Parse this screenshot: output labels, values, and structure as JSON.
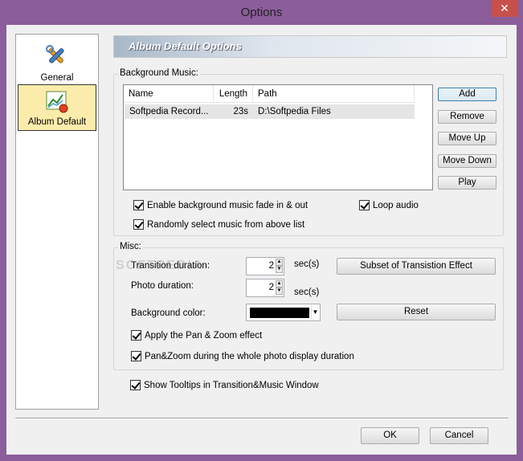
{
  "window": {
    "title": "Options",
    "close_glyph": "✕"
  },
  "nav": {
    "items": [
      {
        "label": "General",
        "icon": "tools-icon",
        "selected": false
      },
      {
        "label": "Album Default",
        "icon": "album-chart-icon",
        "selected": true
      }
    ]
  },
  "header": {
    "title": "Album Default Options"
  },
  "background_music": {
    "legend": "Background Music:",
    "columns": [
      "Name",
      "Length",
      "Path"
    ],
    "rows": [
      {
        "name": "Softpedia Record...",
        "length": "23s",
        "path": "D:\\Softpedia Files"
      }
    ],
    "buttons": {
      "add": "Add",
      "remove": "Remove",
      "move_up": "Move Up",
      "move_down": "Move Down",
      "play": "Play"
    },
    "fade_label": "Enable background music fade in & out",
    "loop_label": "Loop audio",
    "random_label": "Randomly select music from above list"
  },
  "misc": {
    "legend": "Misc:",
    "transition_label": "Transition duration:",
    "transition_value": "2",
    "transition_unit": "sec(s)",
    "photo_label": "Photo duration:",
    "photo_value": "2",
    "photo_unit": "sec(s)",
    "subset_button": "Subset of Transistion Effect",
    "bgcolor_label": "Background color:",
    "bgcolor_value": "#000000",
    "reset_button": "Reset",
    "pan_zoom_label": "Apply the Pan & Zoom effect",
    "pan_zoom_whole_label": "Pan&Zoom during the whole photo display duration"
  },
  "tooltips_label": "Show Tooltips in Transition&Music Window",
  "footer": {
    "ok": "OK",
    "cancel": "Cancel"
  },
  "watermark": "SOFTPEDIA",
  "colors": {
    "titlebar": "#8b5d9a",
    "close": "#c7504c",
    "selected_nav": "#fcecab"
  }
}
